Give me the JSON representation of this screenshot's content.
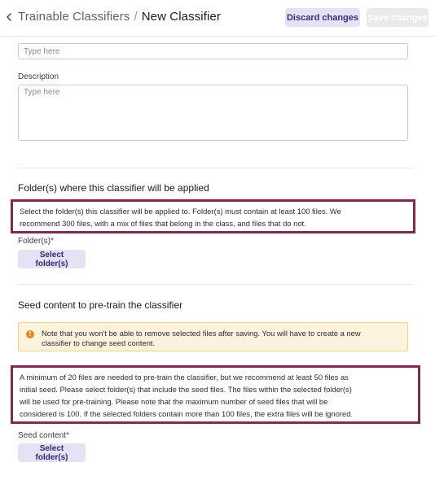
{
  "header": {
    "breadcrumb_parent": "Trainable Classifiers",
    "breadcrumb_separator": "/",
    "breadcrumb_current": "New Classifier",
    "discard_label": "Discard changes",
    "save_label": "Save changes"
  },
  "form": {
    "name_placeholder": "Type here",
    "description_label": "Description",
    "description_placeholder": "Type here"
  },
  "folders_section": {
    "title": "Folder(s) where this classifier will be applied",
    "help_line1": "Select the folder(s) this classifier will be applied to. Folder(s) must contain at least 100 files. We",
    "help_line2": "recommend 300 files, with a mix of files that belong in the class, and files that do not.",
    "field_label": "Folder(s)",
    "required_mark": "*",
    "button_label": "Select folder(s)"
  },
  "seed_section": {
    "title": "Seed content to pre-train the classifier",
    "warning_icon": "!",
    "warning_line1": "Note that you won't be able to remove selected files after saving. You will have to create a new",
    "warning_line2": "classifier to change seed content.",
    "help_line1": "A minimum of 20 files are needed to pre-train the classifier, but we recommend at least 50 files as",
    "help_line2": "initial seed. Please select folder(s) that include the seed files. The files within the selected folder(s)",
    "help_line3": "will be used for pre-training. Please note that the maximum number of seed files that will be",
    "help_line4": "considered is 100. If the selected folders contain more than 100 files, the extra files will be ignored.",
    "field_label": "Seed content",
    "required_mark": "*",
    "button_label": "Select folder(s)"
  },
  "colors": {
    "accent": "#3b2c7a",
    "button_bg": "#e6e2f5",
    "highlight_border": "#7a2c52",
    "warning_bg": "#fdf2db",
    "warning_icon": "#e08a1e",
    "required": "#c0262f"
  },
  "icons": {
    "back": "chevron-left-icon",
    "warning": "warning-circle-icon"
  }
}
